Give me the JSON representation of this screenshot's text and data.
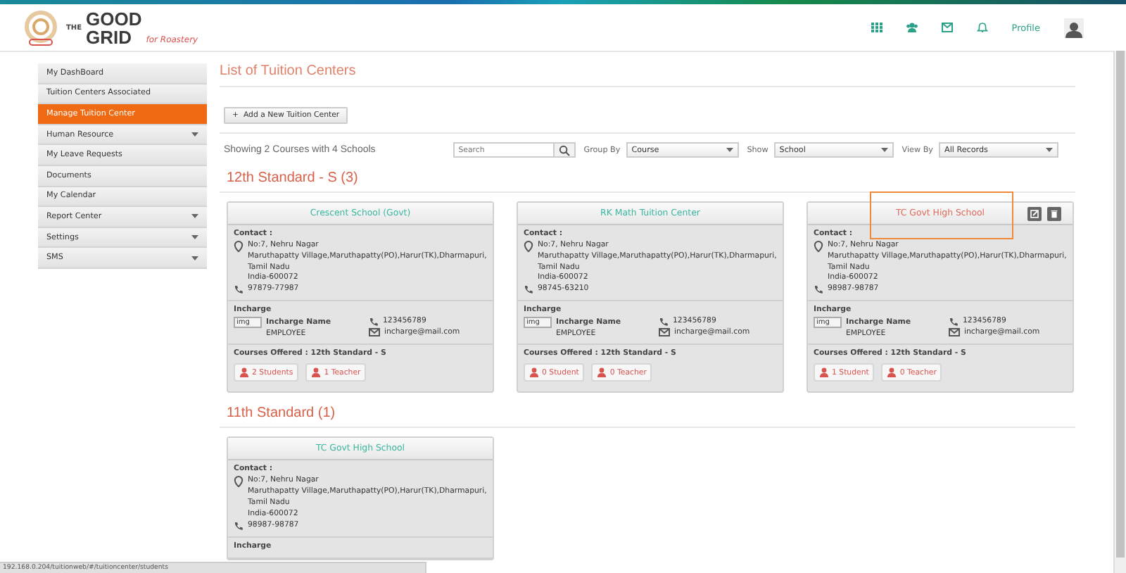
{
  "header": {
    "logo_text": [
      "THE",
      "GOOD",
      "GRID",
      "for Roastery"
    ],
    "profile_label": "Profile"
  },
  "sidebar": {
    "items": [
      {
        "label": "My DashBoard",
        "selected": false,
        "expandable": false
      },
      {
        "label": "Tuition Centers Associated",
        "selected": false,
        "expandable": false
      },
      {
        "label": "Manage Tuition Center",
        "selected": true,
        "expandable": false
      },
      {
        "label": "Human Resource",
        "selected": false,
        "expandable": true
      },
      {
        "label": "My Leave Requests",
        "selected": false,
        "expandable": false
      },
      {
        "label": "Documents",
        "selected": false,
        "expandable": false
      },
      {
        "label": "My Calendar",
        "selected": false,
        "expandable": false
      },
      {
        "label": "Report Center",
        "selected": false,
        "expandable": true
      },
      {
        "label": "Settings",
        "selected": false,
        "expandable": true
      },
      {
        "label": "SMS",
        "selected": false,
        "expandable": true
      }
    ]
  },
  "page_title": "List of Tuition Centers",
  "add_button": {
    "icon": "+",
    "label": "Add a New Tuition Center"
  },
  "summary": "Showing 2 Courses with 4 Schools",
  "filters": {
    "search_placeholder": "Search",
    "group_by": {
      "label": "Group By",
      "value": "Course"
    },
    "show": {
      "label": "Show",
      "value": "School"
    },
    "view_by": {
      "label": "View By",
      "value": "All Records"
    }
  },
  "groups": [
    {
      "title": "12th Standard - S (3)",
      "cards": [
        {
          "name": "Crescent School (Govt)",
          "hovered": false,
          "contact_label": "Contact :",
          "address": [
            "No:7, Nehru Nagar",
            "Maruthapatty Village,Maruthapatty(PO),Harur(TK),Dharmapuri,",
            "Tamil Nadu",
            "India-600072"
          ],
          "phone": "97879-77987",
          "incharge_label": "Incharge",
          "incharge": {
            "img_alt": "img",
            "name": "Incharge Name",
            "role": "EMPLOYEE",
            "phone": "123456789",
            "email": "incharge@mail.com"
          },
          "courses": "Courses Offered : 12th Standard - S",
          "students": "2  Students",
          "teachers": "1 Teacher"
        },
        {
          "name": "RK Math Tuition Center",
          "hovered": false,
          "contact_label": "Contact :",
          "address": [
            "No:7, Nehru Nagar",
            "Maruthapatty Village,Maruthapatty(PO),Harur(TK),Dharmapuri,",
            "Tamil Nadu",
            "India-600072"
          ],
          "phone": "98745-63210",
          "incharge_label": "Incharge",
          "incharge": {
            "img_alt": "img",
            "name": "Incharge Name",
            "role": "EMPLOYEE",
            "phone": "123456789",
            "email": "incharge@mail.com"
          },
          "courses": "Courses Offered : 12th Standard - S",
          "students": "0  Student",
          "teachers": "0 Teacher"
        },
        {
          "name": "TC Govt High School",
          "hovered": true,
          "contact_label": "Contact :",
          "address": [
            "No:7, Nehru Nagar",
            "Maruthapatty Village,Maruthapatty(PO),Harur(TK),Dharmapuri,",
            "Tamil Nadu",
            "India-600072"
          ],
          "phone": "98987-98787",
          "incharge_label": "Incharge",
          "incharge": {
            "img_alt": "img",
            "name": "Incharge Name",
            "role": "EMPLOYEE",
            "phone": "123456789",
            "email": "incharge@mail.com"
          },
          "courses": "Courses Offered : 12th Standard - S",
          "students": "1  Student",
          "teachers": "0 Teacher"
        }
      ]
    },
    {
      "title": "11th Standard (1)",
      "cards": [
        {
          "name": "TC Govt High School",
          "hovered": false,
          "contact_label": "Contact :",
          "address": [
            "No:7, Nehru Nagar",
            "Maruthapatty Village,Maruthapatty(PO),Harur(TK),Dharmapuri,",
            "Tamil Nadu",
            "India-600072"
          ],
          "phone": "98987-98787",
          "incharge_label": "Incharge"
        }
      ]
    }
  ],
  "status_url": "192.168.0.204/tuitionweb/#/tuitioncenter/students"
}
